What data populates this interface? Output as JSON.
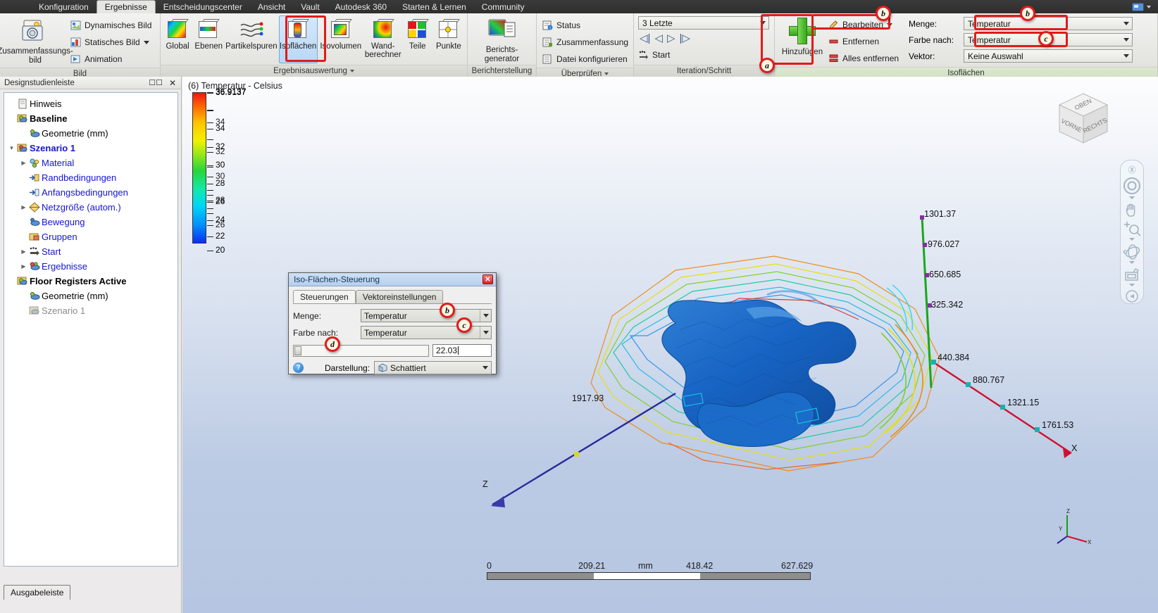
{
  "ribbon": {
    "tabs": [
      {
        "label": "Konfiguration",
        "active": false
      },
      {
        "label": "Ergebnisse",
        "active": true
      },
      {
        "label": "Entscheidungscenter",
        "active": false
      },
      {
        "label": "Ansicht",
        "active": false
      },
      {
        "label": "Vault",
        "active": false
      },
      {
        "label": "Autodesk 360",
        "active": false
      },
      {
        "label": "Starten & Lernen",
        "active": false
      },
      {
        "label": "Community",
        "active": false
      }
    ],
    "panels": {
      "bild": {
        "title": "Bild",
        "big_button": "Zusammenfassungs-bild",
        "items": [
          {
            "label": "Dynamisches Bild",
            "icon": "dynamic-image-icon"
          },
          {
            "label": "Statisches Bild",
            "icon": "static-image-icon",
            "has_caret": true
          },
          {
            "label": "Animation",
            "icon": "animation-icon"
          }
        ]
      },
      "ergebnisauswertung": {
        "title": "Ergebnisauswertung",
        "buttons": [
          {
            "label": "Global",
            "icon": "global-results-icon",
            "selected": false
          },
          {
            "label": "Ebenen",
            "icon": "planes-icon",
            "selected": false
          },
          {
            "label": "Partikelspuren",
            "icon": "particle-traces-icon",
            "selected": false
          },
          {
            "label": "Isoflächen",
            "icon": "isosurfaces-icon",
            "selected": true
          },
          {
            "label": "Isovolumen",
            "icon": "isovolumes-icon",
            "selected": false
          },
          {
            "label": "Wand-berechner",
            "icon": "wall-calculator-icon",
            "selected": false
          },
          {
            "label": "Teile",
            "icon": "parts-icon",
            "selected": false
          },
          {
            "label": "Punkte",
            "icon": "points-icon",
            "selected": false
          }
        ]
      },
      "berichterstellung": {
        "title": "Berichterstellung",
        "big_button": "Berichts-generator"
      },
      "ueberpruefen": {
        "title": "Überprüfen",
        "items": [
          {
            "label": "Status",
            "icon": "status-icon"
          },
          {
            "label": "Zusammenfassung",
            "icon": "summary-icon"
          },
          {
            "label": "Datei konfigurieren",
            "icon": "configure-file-icon"
          }
        ]
      },
      "iteration": {
        "title": "Iteration/Schritt",
        "combo_value": "3 Letzte",
        "nav_icons": [
          "skip-first-icon",
          "step-back-icon",
          "step-forward-icon",
          "skip-last-icon"
        ],
        "start_label": "Start"
      },
      "isoflaechen": {
        "title": "Isoflächen",
        "add_label": "Hinzufügen",
        "edit_label": "Bearbeiten",
        "remove_label": "Entfernen",
        "remove_all_label": "Alles entfernen",
        "fields": [
          {
            "label": "Menge:",
            "value": "Temperatur"
          },
          {
            "label": "Farbe nach:",
            "value": "Temperatur"
          },
          {
            "label": "Vektor:",
            "value": "Keine Auswahl"
          }
        ]
      }
    }
  },
  "annotations": [
    {
      "id": "a",
      "label": "a"
    },
    {
      "id": "b1",
      "label": "b"
    },
    {
      "id": "b2",
      "label": "b"
    },
    {
      "id": "c1",
      "label": "c"
    },
    {
      "id": "b3",
      "label": "b"
    },
    {
      "id": "c2",
      "label": "c"
    },
    {
      "id": "d",
      "label": "d"
    }
  ],
  "sidebar": {
    "title": "Designstudienleiste",
    "output_tab": "Ausgabeleiste",
    "tree": [
      {
        "label": "Hinweis",
        "indent": 0,
        "arrow": "",
        "style": "black",
        "icon": "note-icon"
      },
      {
        "label": "Baseline",
        "indent": 0,
        "arrow": "",
        "style": "bold",
        "icon": "study-icon"
      },
      {
        "label": "Geometrie (mm)",
        "indent": 1,
        "arrow": "",
        "style": "black",
        "icon": "geometry-icon"
      },
      {
        "label": "Szenario 1",
        "indent": 0,
        "arrow": "down",
        "style": "link-bold",
        "icon": "scenario-icon"
      },
      {
        "label": "Material",
        "indent": 2,
        "arrow": "right",
        "style": "link",
        "icon": "material-icon"
      },
      {
        "label": "Randbedingungen",
        "indent": 2,
        "arrow": "",
        "style": "link",
        "icon": "boundary-icon"
      },
      {
        "label": "Anfangsbedingungen",
        "indent": 2,
        "arrow": "",
        "style": "link",
        "icon": "initial-icon"
      },
      {
        "label": "Netzgröße (autom.)",
        "indent": 2,
        "arrow": "right",
        "style": "link",
        "icon": "mesh-icon"
      },
      {
        "label": "Bewegung",
        "indent": 2,
        "arrow": "",
        "style": "link",
        "icon": "motion-icon"
      },
      {
        "label": "Gruppen",
        "indent": 2,
        "arrow": "",
        "style": "link",
        "icon": "groups-icon"
      },
      {
        "label": "Start",
        "indent": 2,
        "arrow": "right",
        "style": "link",
        "icon": "solve-icon"
      },
      {
        "label": "Ergebnisse",
        "indent": 2,
        "arrow": "right",
        "style": "link",
        "icon": "results-icon"
      },
      {
        "label": "Floor Registers Active",
        "indent": 0,
        "arrow": "",
        "style": "bold",
        "icon": "study-icon"
      },
      {
        "label": "Geometrie (mm)",
        "indent": 1,
        "arrow": "",
        "style": "black",
        "icon": "geometry-icon"
      },
      {
        "label": "Szenario 1",
        "indent": 1,
        "arrow": "",
        "style": "gray",
        "icon": "scenario-icon"
      }
    ]
  },
  "viewport": {
    "title": "(6) Temperatur - Celsius",
    "legend": {
      "unit": "Celsius",
      "max_label": "36.9137",
      "ticks": [
        "36.9137",
        "34",
        "32",
        "30",
        "28",
        "26",
        "24",
        "22",
        "20"
      ]
    },
    "axis_labels": {
      "y_axis": [
        "1301.37",
        "976.027",
        "650.685",
        "325.342"
      ],
      "x_axis": [
        "440.384",
        "880.767",
        "1321.15",
        "1761.53"
      ],
      "z_axis": [
        "1917.93"
      ],
      "x_letter": "X",
      "z_letter": "Z"
    },
    "scale_bar": {
      "labels": [
        "0",
        "209.21",
        "mm",
        "418.42",
        "627.629"
      ]
    },
    "viewcube": {
      "top": "OBEN",
      "front": "VORNE",
      "right": "RECHTS"
    },
    "triad": {
      "z": "Z",
      "y": "Y",
      "x": "X"
    }
  },
  "dialog": {
    "title": "Iso-Flächen-Steuerung",
    "close_label": "✕",
    "tabs": [
      {
        "label": "Steuerungen",
        "active": true
      },
      {
        "label": "Vektoreinstellungen",
        "active": false
      }
    ],
    "fields": [
      {
        "label": "Menge:",
        "value": "Temperatur"
      },
      {
        "label": "Farbe nach:",
        "value": "Temperatur"
      }
    ],
    "slider_value": "22.03",
    "display_label": "Darstellung:",
    "display_value": "Schattiert"
  },
  "colors": {
    "accent_red": "#e01b1b",
    "tree_link": "#1414d0",
    "green_plus": "#35a81a",
    "selection_blue": "#b8d8f6"
  }
}
